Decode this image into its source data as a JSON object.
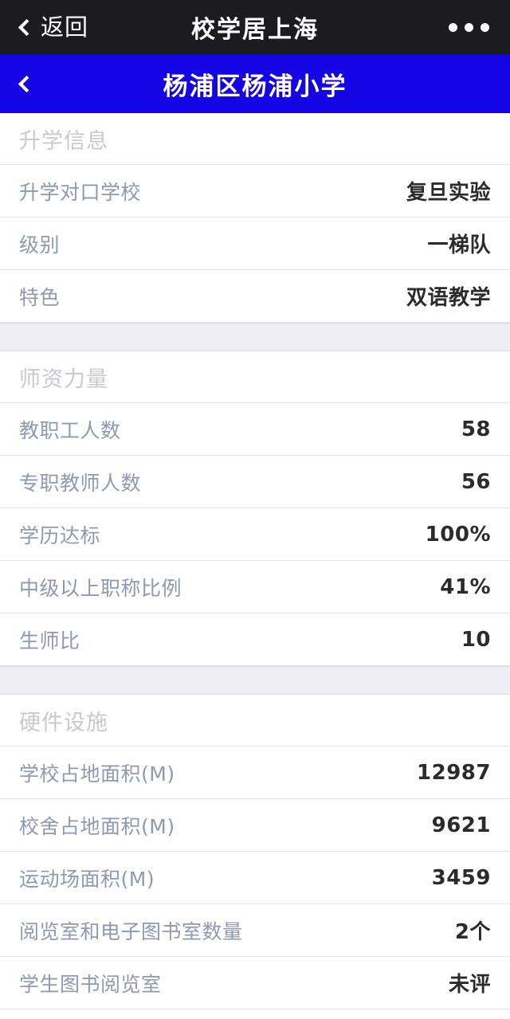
{
  "topbar": {
    "back_label": "返回",
    "title": "校学居上海",
    "more_icon": "ellipsis-icon"
  },
  "navbar": {
    "back_icon": "chevron-left-icon",
    "title": "杨浦区杨浦小学"
  },
  "sections": [
    {
      "header": "升学信息",
      "rows": [
        {
          "label": "升学对口学校",
          "value": "复旦实验"
        },
        {
          "label": "级别",
          "value": "一梯队"
        },
        {
          "label": "特色",
          "value": "双语教学"
        }
      ]
    },
    {
      "header": "师资力量",
      "rows": [
        {
          "label": "教职工人数",
          "value": "58"
        },
        {
          "label": "专职教师人数",
          "value": "56"
        },
        {
          "label": "学历达标",
          "value": "100%"
        },
        {
          "label": "中级以上职称比例",
          "value": "41%"
        },
        {
          "label": "生师比",
          "value": "10"
        }
      ]
    },
    {
      "header": "硬件设施",
      "rows": [
        {
          "label": "学校占地面积(M)",
          "value": "12987"
        },
        {
          "label": "校舍占地面积(M)",
          "value": "9621"
        },
        {
          "label": "运动场面积(M)",
          "value": "3459"
        },
        {
          "label": "阅览室和电子图书室数量",
          "value": "2个"
        },
        {
          "label": "学生图书阅览室",
          "value": "未评"
        }
      ]
    }
  ],
  "colors": {
    "topbar_bg": "#1c1c1e",
    "navbar_bg": "#1504e3",
    "section_gap_bg": "#eeeef4",
    "label_text": "#8e99b4",
    "value_text": "#2b2b2b",
    "header_text": "#c9c9cf",
    "divider": "#e4e4e8"
  }
}
